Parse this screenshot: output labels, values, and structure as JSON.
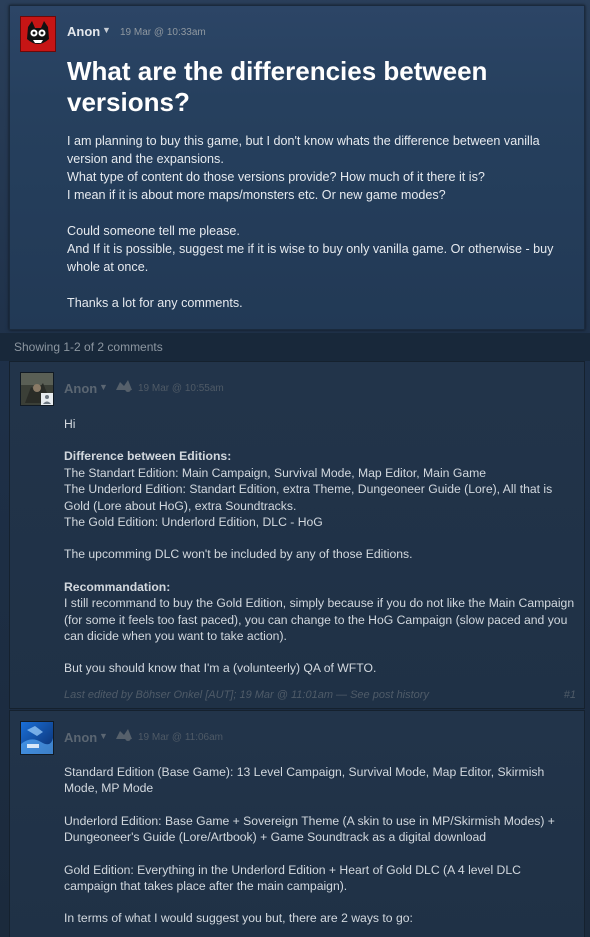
{
  "op": {
    "author": "Anon",
    "date": "19 Mar @ 10:33am",
    "title": "What are the differencies between versions?",
    "body": [
      "I am planning to buy this game, but I don't know whats the difference between vanilla version and the expansions.",
      "What type of content do those versions provide? How much of it there it is?",
      "I mean if it is about more maps/monsters etc. Or new game modes?",
      "",
      "Could someone tell me please.",
      "And If it is possible, suggest me if it is wise to buy only vanilla game. Or otherwise - buy whole at once.",
      "",
      "Thanks a lot for any comments."
    ]
  },
  "showing": "Showing 1-2 of 2 comments",
  "comments": [
    {
      "author": "Anon",
      "date": "19 Mar @ 10:55am",
      "lines": {
        "hi": "Hi",
        "diff_heading": "Difference between Editions:",
        "std": "The Standart Edition: Main Campaign, Survival Mode, Map Editor, Main Game",
        "under": "The Underlord Edition: Standart Edition, extra Theme, Dungeoneer Guide (Lore), All that is Gold (Lore about HoG), extra Soundtracks.",
        "gold": "The Gold Edition: Underlord Edition, DLC - HoG",
        "dlc": "The upcomming DLC won't be included by any of those Editions.",
        "rec_heading": "Recommandation:",
        "rec": "I still recommand to buy the Gold Edition, simply because if you do not like the Main Campaign (for some it feels too fast paced), you can change to the HoG Campaign (slow paced and you can dicide when you want to take action).",
        "qa": "But you should know that I'm a (volunteerly) QA of WFTO."
      },
      "edit_note": "Last edited by Böhser Onkel [AUT]; 19 Mar @ 11:01am — See post history",
      "number": "#1"
    },
    {
      "author": "Anon",
      "date": "19 Mar @ 11:06am",
      "lines": {
        "std": "Standard Edition (Base Game): 13 Level Campaign, Survival Mode, Map Editor, Skirmish Mode, MP Mode",
        "under": "Underlord Edition: Base Game + Sovereign Theme (A skin to use in MP/Skirmish Modes) + Dungeoneer's Guide (Lore/Artbook) + Game Soundtrack as a digital download",
        "gold": "Gold Edition: Everything in the Underlord Edition + Heart of Gold DLC (A 4 level DLC campaign that takes place after the main campaign).",
        "suggest": "In terms of what I would suggest you but, there are 2 ways to go:"
      }
    }
  ],
  "icons": {
    "caret": "dropdown-caret-icon",
    "badge": "developer-badge-icon",
    "person": "person-icon"
  }
}
